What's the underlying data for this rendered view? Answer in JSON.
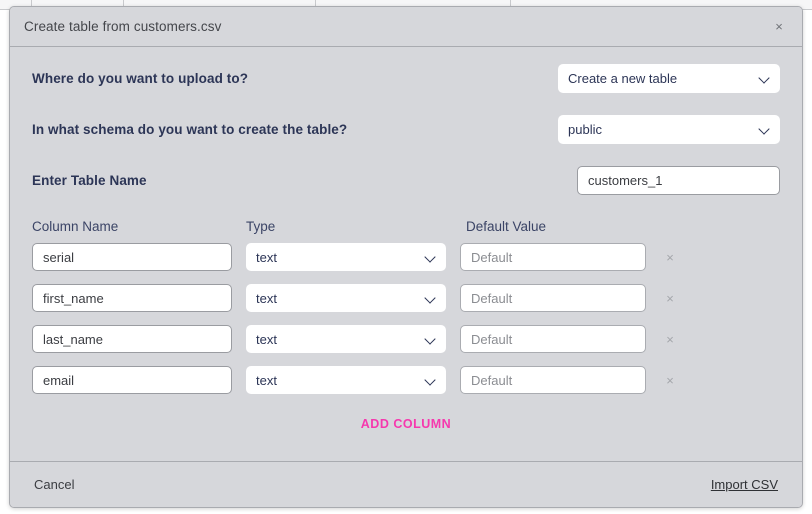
{
  "background": {
    "table_header_columns": [
      "",
      "",
      "",
      "",
      ""
    ]
  },
  "modal": {
    "title": "Create table from customers.csv",
    "close_label": "×",
    "questions": [
      {
        "label": "Where do you want to upload to?",
        "control": "select",
        "value": "Create a new table"
      },
      {
        "label": "In what schema do you want to create the table?",
        "control": "select",
        "value": "public"
      },
      {
        "label": "Enter Table Name",
        "control": "input",
        "value": "customers_1",
        "placeholder": "Enter Table Name"
      }
    ],
    "columns_section": {
      "headers": {
        "name": "Column Name",
        "type": "Type",
        "default": "Default Value"
      },
      "rows": [
        {
          "name": "serial",
          "name_placeholder": "Column Name",
          "type": "text",
          "default_value": "",
          "default_placeholder": "Default",
          "remove_label": "×"
        },
        {
          "name": "first_name",
          "name_placeholder": "Column Name",
          "type": "text",
          "default_value": "",
          "default_placeholder": "Default",
          "remove_label": "×"
        },
        {
          "name": "last_name",
          "name_placeholder": "Column Name",
          "type": "text",
          "default_value": "",
          "default_placeholder": "Default",
          "remove_label": "×"
        },
        {
          "name": "email",
          "name_placeholder": "Column Name",
          "type": "text",
          "default_value": "",
          "default_placeholder": "Default",
          "remove_label": "×"
        }
      ],
      "add_column_label": "ADD COLUMN"
    },
    "footer": {
      "cancel_label": "Cancel",
      "import_label": "Import CSV"
    }
  },
  "colors": {
    "modal_bg": "#d6d7db",
    "label_text": "#2c3556",
    "accent_pink": "#f638ae",
    "input_bg": "#ffffff",
    "border": "#a9abb0"
  },
  "icons": {
    "chevron_down": "chevron-down-icon",
    "close": "close-icon",
    "remove_row": "remove-row-icon"
  }
}
